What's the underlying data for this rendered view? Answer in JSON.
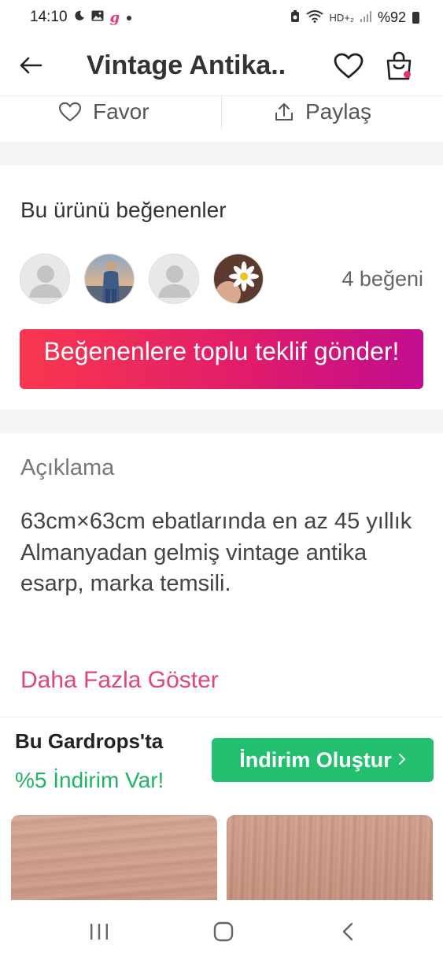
{
  "status_bar": {
    "time": "14:10",
    "battery": "%92",
    "left_icons": [
      "moon-icon",
      "image-icon",
      "gardrops-app-icon",
      "dot-icon"
    ],
    "right_icons": [
      "sync-icon",
      "wifi-icon",
      "hd-voice-icon",
      "signal-icon",
      "battery-icon"
    ],
    "app_glyph": "g",
    "hd_label": "HD+₂"
  },
  "header": {
    "title": "Vintage Antika..",
    "cart_badge_color": "#e8336a"
  },
  "actions": {
    "favor_label": "Favor",
    "share_label": "Paylaş"
  },
  "likers": {
    "title": "Bu ürünü beğenenler",
    "count_label": "4 beğeni",
    "avatars": [
      "default-avatar",
      "person-photo-avatar",
      "default-avatar",
      "daisy-photo-avatar"
    ],
    "offer_button": "Beğenenlere toplu teklif gönder!"
  },
  "description": {
    "label": "Açıklama",
    "text": "63cm×63cm ebatlarında en az 45 yıllık Almanyadan gelmiş vintage antika esarp, marka temsili.",
    "more_link": "Daha Fazla Göster"
  },
  "discount": {
    "title": "Bu Gardrops'ta",
    "subtitle": "%5 İndirim Var!",
    "button": "İndirim Oluştur",
    "button_color": "#22c06e"
  },
  "colors": {
    "accent_pink": "#e0437e",
    "gradient_start": "#f8384e",
    "gradient_end": "#c10d8f",
    "success_green": "#1fb464"
  },
  "nav_bar": {
    "buttons": [
      "recents-icon",
      "home-icon",
      "back-icon"
    ]
  }
}
